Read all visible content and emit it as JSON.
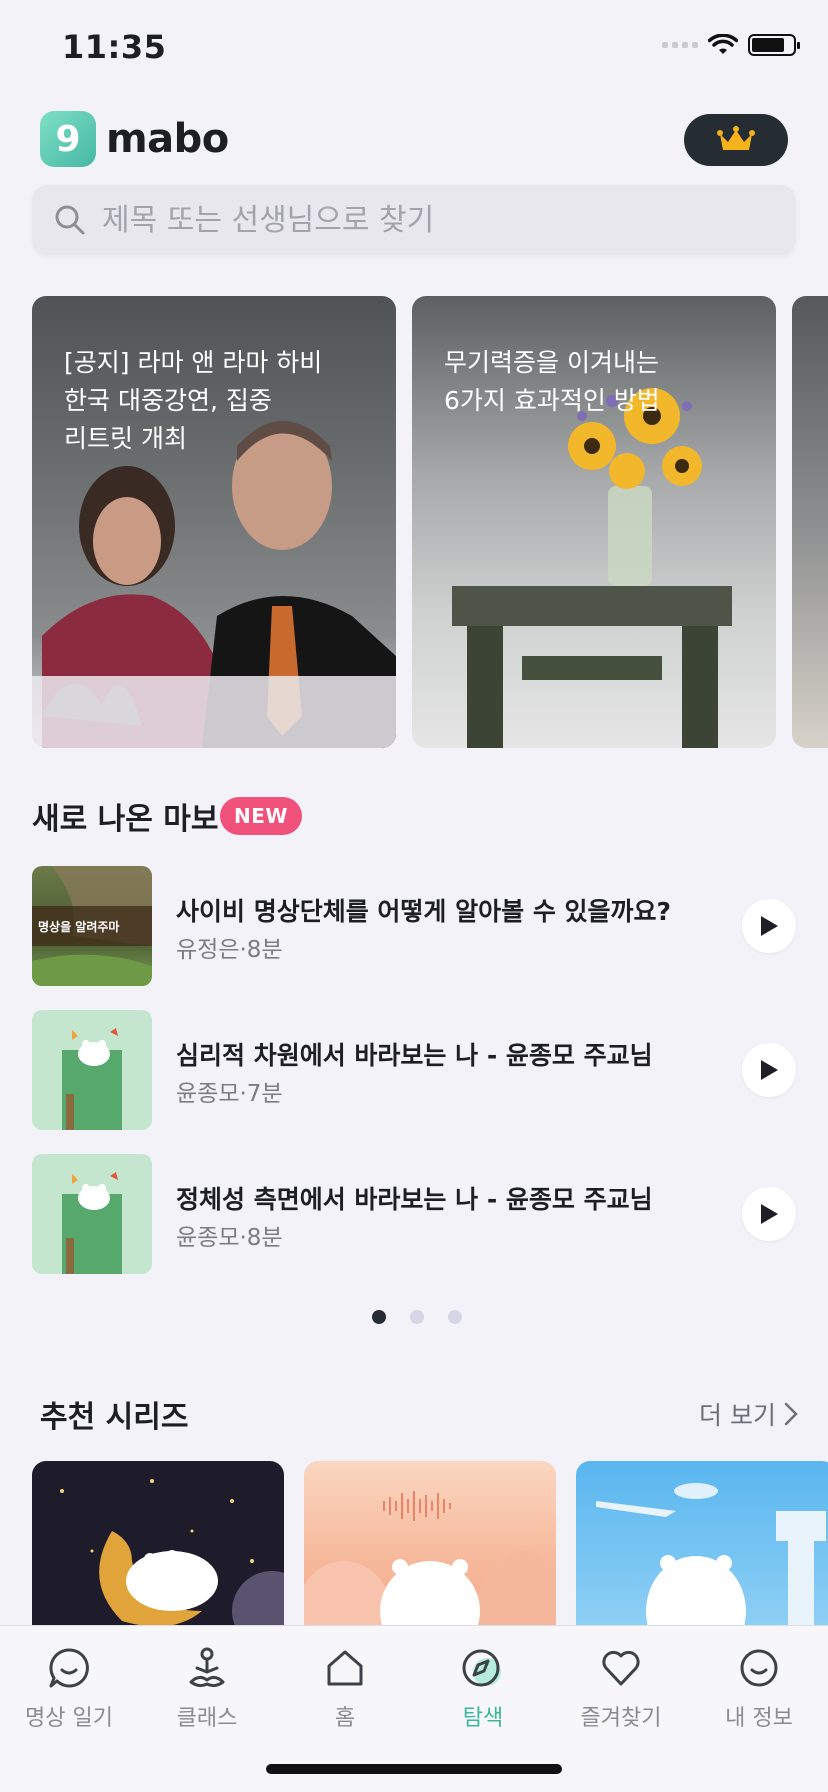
{
  "status_bar": {
    "time": "11:35"
  },
  "header": {
    "logo_text": "mabo",
    "logo_mark": "9",
    "premium_icon": "crown-icon"
  },
  "search": {
    "placeholder": "제목 또는 선생님으로 찾기"
  },
  "banners": [
    {
      "title": "[공지] 라마 앤 라마 하비\n한국 대중강연, 집중\n리트릿 개최"
    },
    {
      "title": "무기력증을 이겨내는\n6가지 효과적인 방법"
    },
    {
      "title": ""
    }
  ],
  "new_section": {
    "title": "새로 나온 마보",
    "badge": "NEW",
    "tracks": [
      {
        "title": "사이비 명상단체를 어떻게 알아볼 수 있을까요?",
        "meta": "유정은·8분",
        "thumb_caption": "명상을 알려주마"
      },
      {
        "title": "심리적 차원에서 바라보는 나 - 윤종모 주교님",
        "meta": "윤종모·7분"
      },
      {
        "title": "정체성 측면에서 바라보는 나 - 윤종모 주교님",
        "meta": "윤종모·8분"
      }
    ],
    "page_count": 3,
    "active_page": 1
  },
  "series_section": {
    "title": "추천 시리즈",
    "more_label": "더 보기"
  },
  "tabbar": {
    "items": [
      {
        "label": "명상 일기",
        "icon": "chat-smile-icon"
      },
      {
        "label": "클래스",
        "icon": "meditation-person-icon"
      },
      {
        "label": "홈",
        "icon": "home-icon"
      },
      {
        "label": "탐색",
        "icon": "compass-icon",
        "active": true
      },
      {
        "label": "즐겨찾기",
        "icon": "heart-icon"
      },
      {
        "label": "내 정보",
        "icon": "smile-face-icon"
      }
    ]
  },
  "colors": {
    "accent": "#3cb79c",
    "badge": "#f0517a",
    "dark": "#252d33",
    "background": "#f3f2f9"
  }
}
